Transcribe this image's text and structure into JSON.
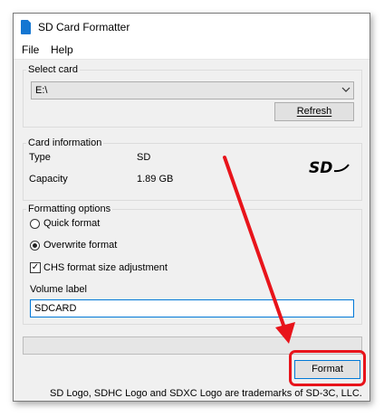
{
  "window": {
    "title": "SD Card Formatter",
    "icon": "sd-card-icon"
  },
  "menu": {
    "items": [
      "File",
      "Help"
    ]
  },
  "select_card": {
    "title": "Select card",
    "drive": "E:\\",
    "refresh_label": "Refresh"
  },
  "card_info": {
    "title": "Card information",
    "type_label": "Type",
    "type_value": "SD",
    "capacity_label": "Capacity",
    "capacity_value": "1.89 GB",
    "logo": "SD"
  },
  "formatting": {
    "title": "Formatting options",
    "quick_label": "Quick format",
    "overwrite_label": "Overwrite format",
    "selected": "Overwrite format",
    "chs_label": "CHS format size adjustment",
    "chs_checked": true,
    "volume_label_title": "Volume label",
    "volume_label_value": "SDCARD"
  },
  "progress": 0,
  "format_label": "Format",
  "footer": "SD Logo, SDHC Logo and SDXC Logo are trademarks of SD-3C, LLC.",
  "annotation": {
    "color": "#e8141b"
  }
}
